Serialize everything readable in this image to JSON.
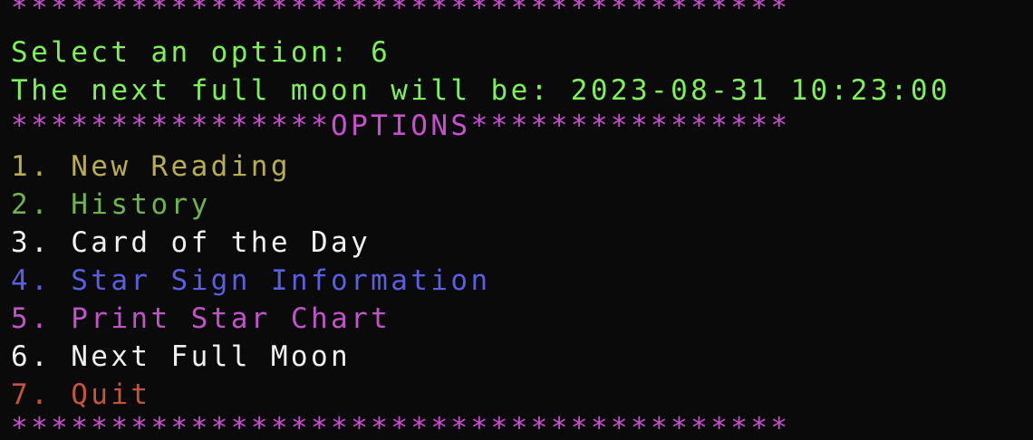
{
  "terminal": {
    "border_top": "***************************************",
    "prompt_line": "Select an option: 6",
    "result_line": "The next full moon will be: 2023-08-31 10:23:00",
    "options_header": "****************OPTIONS****************",
    "options": [
      {
        "label": "1. New Reading",
        "color": "#b9ad54"
      },
      {
        "label": "2. History",
        "color": "#6fb34e"
      },
      {
        "label": "3. Card of the Day",
        "color": "#f0f0f0"
      },
      {
        "label": "4. Star Sign Information",
        "color": "#5a5ee0"
      },
      {
        "label": "5. Print Star Chart",
        "color": "#c054c8"
      },
      {
        "label": "6. Next Full Moon",
        "color": "#f0f0f0"
      },
      {
        "label": "7. Quit",
        "color": "#c4553a"
      }
    ],
    "border_bottom": "***************************************"
  },
  "colors": {
    "background": "#0a0a0a",
    "stars": "#c94fd0",
    "prompt": "#7df05a"
  }
}
